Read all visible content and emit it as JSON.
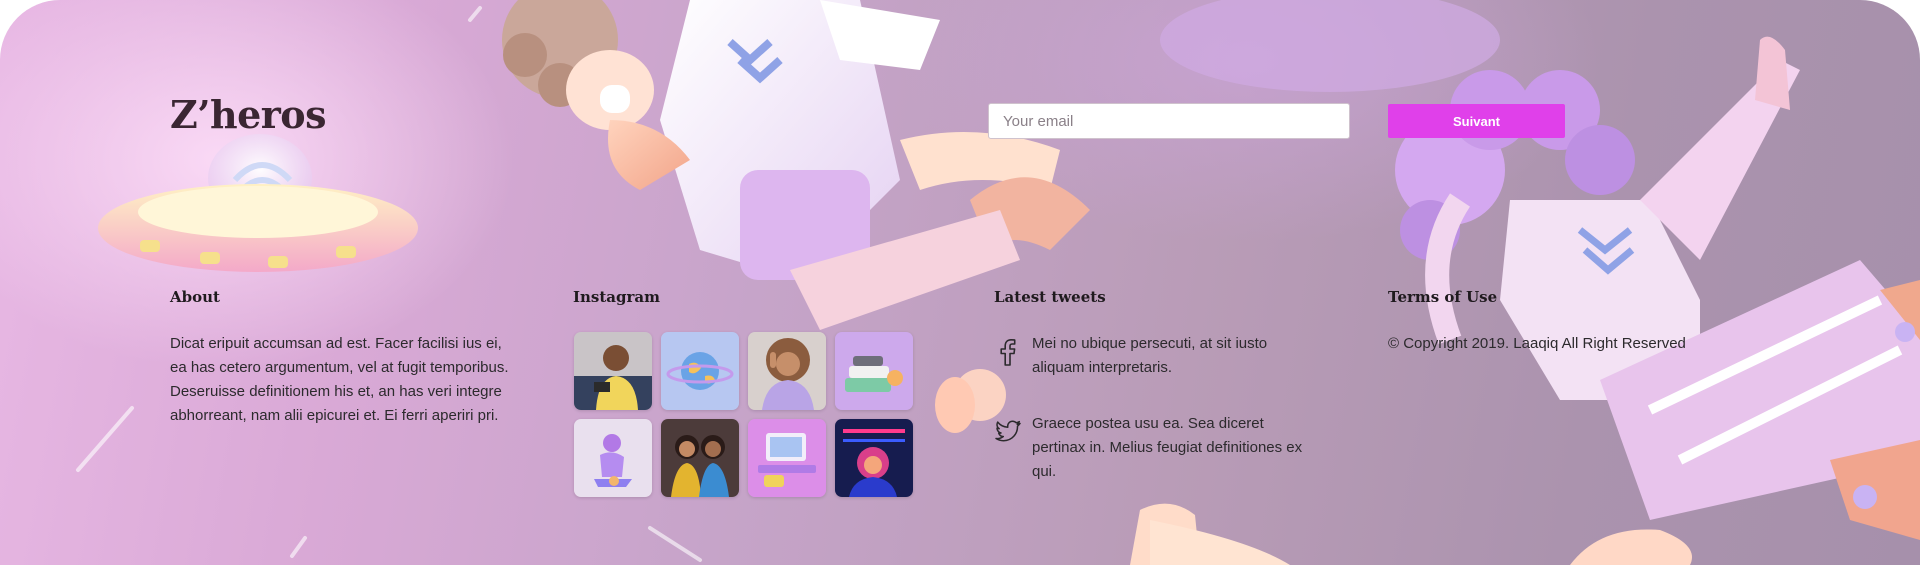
{
  "brand": {
    "logo": "Z’heros"
  },
  "newsletter": {
    "placeholder": "Your email",
    "button_label": "Suivant"
  },
  "about": {
    "heading": "About",
    "text": "Dicat eripuit accumsan ad est. Facer facilisi ius ei, ea has cetero argumentum, vel at fugit temporibus. Deseruisse definitionem his et, an has veri integre abhorreant, nam alii epicurei et. Ei ferri aperiri pri."
  },
  "instagram": {
    "heading": "Instagram",
    "photos": [
      "man-with-phone",
      "globe-3d",
      "woman-peace-sign",
      "stacked-gadgets",
      "3d-character-sitting",
      "two-women-selfie",
      "3d-desk-workspace",
      "neon-gamer"
    ]
  },
  "tweets": {
    "heading": "Latest tweets",
    "items": [
      {
        "icon": "facebook-icon",
        "text": "Mei no ubique persecuti, at sit iusto aliquam interpretaris."
      },
      {
        "icon": "twitter-icon",
        "text": "Graece postea usu ea. Sea diceret pertinax in. Melius feugiat definitiones ex qui."
      }
    ]
  },
  "terms": {
    "heading": "Terms of Use",
    "copyright": "© Copyright 2019. Laaqiq All Right Reserved"
  },
  "colors": {
    "accent": "#e040ea",
    "text": "#2c2a2d",
    "heading": "#1f1a1e",
    "logo": "#3a2632"
  }
}
